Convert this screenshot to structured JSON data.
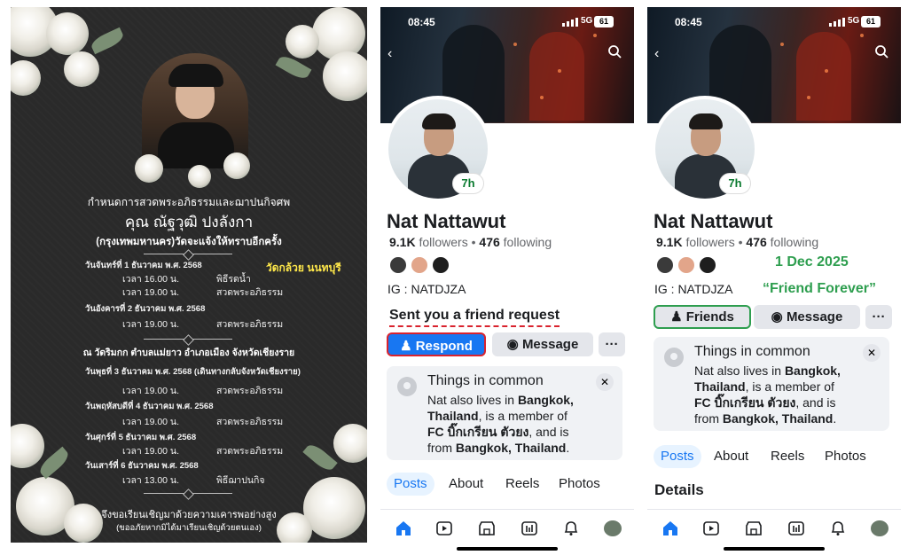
{
  "poster": {
    "heading": "กำหนดการสวดพระอภิธรรมและฌาปนกิจศพ",
    "name": "คุณ ณัฐวุฒิ ปงลังกา",
    "subtitle": "(กรุงเทพมหานคร)วัดจะแจ้งให้ทราบอีกครั้ง",
    "note": "วัดกล้วย นนทบุรี",
    "location": "ณ วัดริมกก ตำบลแม่ยาว อำเภอเมือง จังหวัดเชียงราย",
    "days": [
      {
        "day": "วันจันทร์ที่ 1 ธันวาคม พ.ศ. 2568",
        "rows": [
          {
            "time": "เวลา 16.00 น.",
            "event": "พิธีรดน้ำ"
          },
          {
            "time": "เวลา 19.00 น.",
            "event": "สวดพระอภิธรรม"
          }
        ]
      },
      {
        "day": "วันอังคารที่ 2 ธันวาคม พ.ศ. 2568",
        "rows": [
          {
            "time": "เวลา 19.00 น.",
            "event": "สวดพระอภิธรรม"
          }
        ]
      },
      {
        "day": "วันพุธที่ 3 ธันวาคม พ.ศ. 2568 (เดินทางกลับจังหวัดเชียงราย)",
        "rows": [
          {
            "time": "เวลา 19.00 น.",
            "event": "สวดพระอภิธรรม"
          }
        ]
      },
      {
        "day": "วันพฤหัสบดีที่ 4 ธันวาคม พ.ศ. 2568",
        "rows": [
          {
            "time": "เวลา 19.00 น.",
            "event": "สวดพระอภิธรรม"
          }
        ]
      },
      {
        "day": "วันศุกร์ที่ 5 ธันวาคม พ.ศ. 2568",
        "rows": [
          {
            "time": "เวลา 19.00 น.",
            "event": "สวดพระอภิธรรม"
          }
        ]
      },
      {
        "day": "วันเสาร์ที่ 6 ธันวาคม พ.ศ. 2568",
        "rows": [
          {
            "time": "เวลา 13.00 น.",
            "event": "พิธีฌาปนกิจ"
          }
        ]
      }
    ],
    "footer1": "จึงขอเรียนเชิญมาด้วยความเคารพอย่างสูง",
    "footer2": "(ขออภัยหากมิได้มาเรียนเชิญด้วยตนเอง)"
  },
  "phone_left": {
    "time": "08:45",
    "network": "5G",
    "battery": "61",
    "story_badge": "7h",
    "name": "Nat Nattawut",
    "followers_count": "9.1K",
    "followers_label": "followers",
    "following_count": "476",
    "following_label": "following",
    "ig": "IG : NATDJZA",
    "annotation": "Sent you a friend request",
    "respond_label": "Respond",
    "message_label": "Message",
    "more_label": "···",
    "card_title": "Things in common",
    "card_body": [
      {
        "t": "Nat also lives in ",
        "b": false
      },
      {
        "t": "Bangkok, Thailand",
        "b": true
      },
      {
        "t": ", is a member of ",
        "b": false
      },
      {
        "t": "FC บิ๊กเกรียน ตัวยง",
        "b": true
      },
      {
        "t": ", and is from ",
        "b": false
      },
      {
        "t": "Bangkok, Thailand",
        "b": true
      },
      {
        "t": ".",
        "b": false
      }
    ],
    "tabs": [
      "Posts",
      "About",
      "Reels",
      "Photos"
    ]
  },
  "phone_right": {
    "time": "08:45",
    "network": "5G",
    "battery": "61",
    "story_badge": "7h",
    "name": "Nat Nattawut",
    "followers_count": "9.1K",
    "followers_label": "followers",
    "following_count": "476",
    "following_label": "following",
    "ig": "IG : NATDJZA",
    "date_annotation": "1 Dec 2025",
    "quote_annotation": "“Friend Forever”",
    "friends_label": "Friends",
    "message_label": "Message",
    "more_label": "···",
    "card_title": "Things in common",
    "card_body": [
      {
        "t": "Nat also lives in ",
        "b": false
      },
      {
        "t": "Bangkok, Thailand",
        "b": true
      },
      {
        "t": ", is a member of ",
        "b": false
      },
      {
        "t": "FC บิ๊กเกรียน ตัวยง",
        "b": true
      },
      {
        "t": ", and is from ",
        "b": false
      },
      {
        "t": "Bangkok, Thailand",
        "b": true
      },
      {
        "t": ".",
        "b": false
      }
    ],
    "tabs": [
      "Posts",
      "About",
      "Reels",
      "Photos"
    ],
    "details_label": "Details"
  },
  "colors": {
    "fb_blue": "#1877f2",
    "annotation_green": "#2e9e4f",
    "annotation_red": "#d9232e",
    "poster_bg": "#2a2a2a",
    "note_yellow": "#ffe84a"
  }
}
